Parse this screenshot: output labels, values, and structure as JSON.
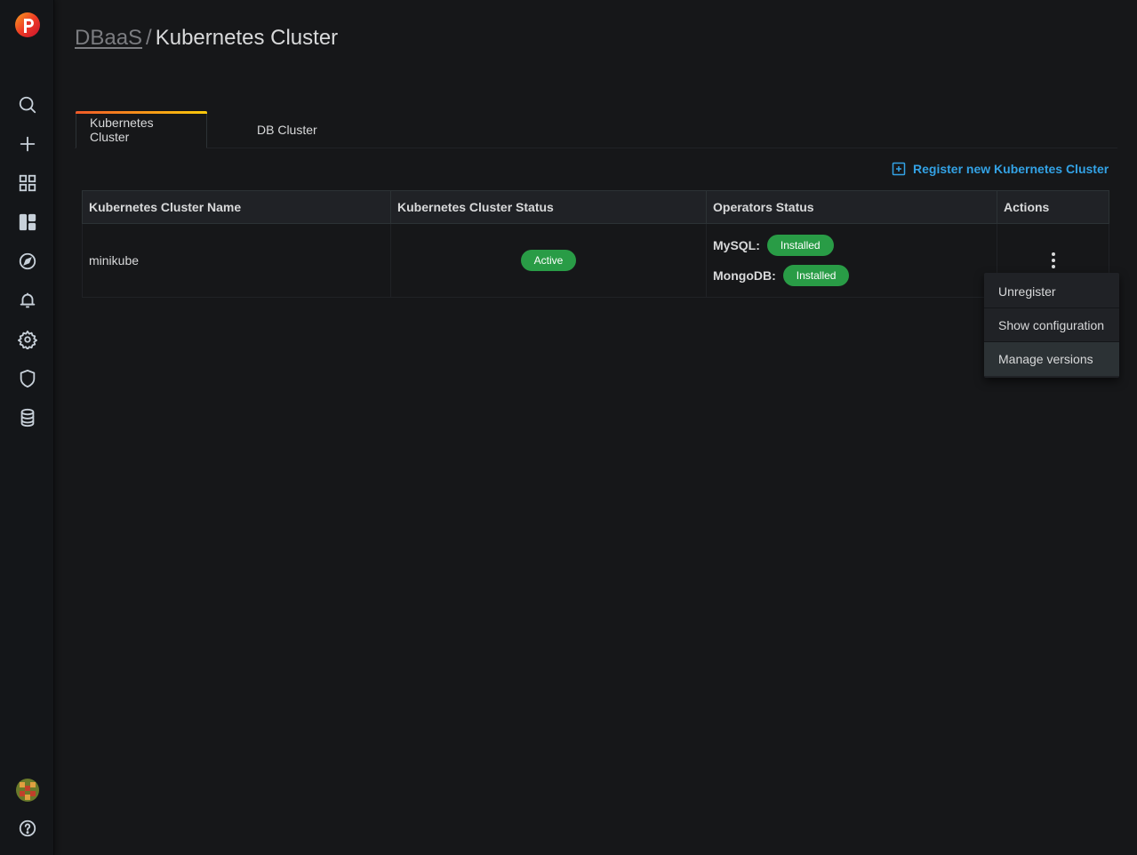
{
  "sidebar": {
    "icons": [
      "search-icon",
      "plus-icon",
      "dashboards-icon",
      "panels-icon",
      "explore-icon",
      "alerting-icon",
      "settings-icon",
      "shield-icon",
      "database-icon"
    ],
    "help_icon": "help-icon"
  },
  "breadcrumb": {
    "parent": "DBaaS",
    "separator": "/",
    "current": "Kubernetes Cluster"
  },
  "tabs": [
    {
      "label": "Kubernetes Cluster",
      "active": true
    },
    {
      "label": "DB Cluster",
      "active": false
    }
  ],
  "register_link": "Register new Kubernetes Cluster",
  "table": {
    "headers": [
      "Kubernetes Cluster Name",
      "Kubernetes Cluster Status",
      "Operators Status",
      "Actions"
    ],
    "rows": [
      {
        "name": "minikube",
        "status": "Active",
        "operators": [
          {
            "label": "MySQL:",
            "status": "Installed"
          },
          {
            "label": "MongoDB:",
            "status": "Installed"
          }
        ]
      }
    ]
  },
  "actions_menu": {
    "items": [
      "Unregister",
      "Show configuration",
      "Manage versions"
    ]
  },
  "colors": {
    "accent_blue": "#33a2e5",
    "success_green": "#299c46",
    "background": "#161719"
  }
}
